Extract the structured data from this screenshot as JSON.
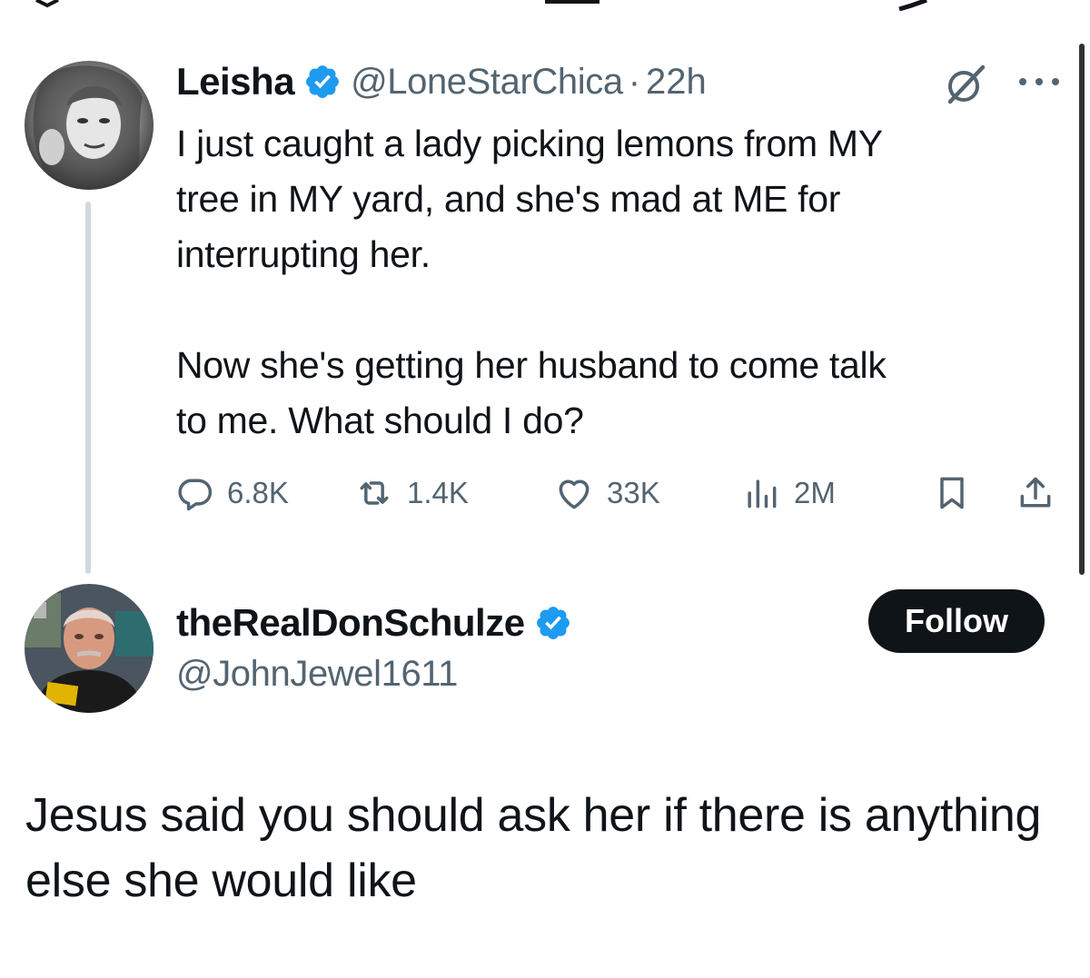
{
  "colors": {
    "verified_blue": "#1d9bf0",
    "secondary_text": "#536471",
    "primary_text": "#0f1419",
    "thread_line": "#cfd9de",
    "follow_button_bg": "#0f1419"
  },
  "tweet": {
    "author_name": "Leisha",
    "handle": "@LoneStarChica",
    "separator": "·",
    "time": "22h",
    "text": "I just caught a lady picking lemons from MY\ntree in MY yard, and she's mad at ME for\ninterrupting her.\n\nNow she's getting her husband to come talk\nto me. What should I do?",
    "icons": {
      "verified": "verified-badge-icon",
      "grok": "grok-icon",
      "more": "more-options-icon"
    },
    "actions": {
      "replies": "6.8K",
      "reposts": "1.4K",
      "likes": "33K",
      "views": "2M"
    }
  },
  "reply": {
    "author_name": "theRealDonSchulze",
    "handle": "@JohnJewel1611",
    "follow_label": "Follow",
    "text": "Jesus said you should ask her if there is anything else she would like"
  }
}
